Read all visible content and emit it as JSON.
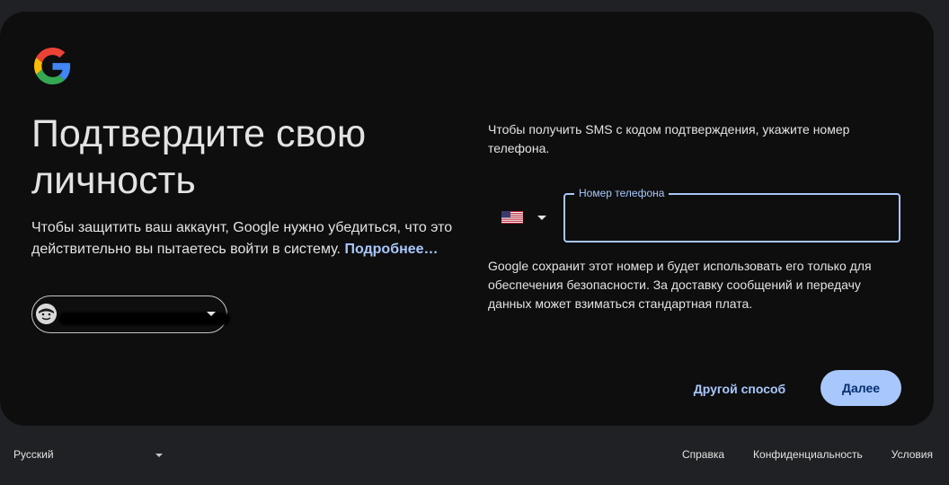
{
  "brand": {
    "logo_icon": "google-g-icon",
    "colors": {
      "blue": "#4285F4",
      "red": "#EA4335",
      "yellow": "#FBBC05",
      "green": "#34A853"
    }
  },
  "main": {
    "title": "Подтвердите свою личность",
    "description": "Чтобы защитить ваш аккаунт, Google нужно убедиться, что это действительно вы пытаетесь войти в систему.",
    "learn_more": "Подробнее…",
    "account_chip": {
      "avatar_icon": "avatar-icon",
      "email": "",
      "dropdown_icon": "chevron-down-icon"
    }
  },
  "phone": {
    "prompt": "Чтобы получить SMS с кодом подтверждения, укажите номер телефона.",
    "country_flag_icon": "us-flag-icon",
    "country_dropdown_icon": "chevron-down-icon",
    "field_label": "Номер телефона",
    "value": "",
    "note": "Google сохранит этот номер и будет использовать его только для обеспечения безопасности. За доставку сообщений и передачу данных может взиматься стандартная плата."
  },
  "actions": {
    "other_way": "Другой способ",
    "next": "Далее"
  },
  "footer": {
    "language": "Русский",
    "links": [
      "Справка",
      "Конфиденциальность",
      "Условия"
    ]
  },
  "theme": {
    "accent": "#a8c7fa",
    "card_bg": "#0e0e0f",
    "page_bg": "#202124"
  }
}
